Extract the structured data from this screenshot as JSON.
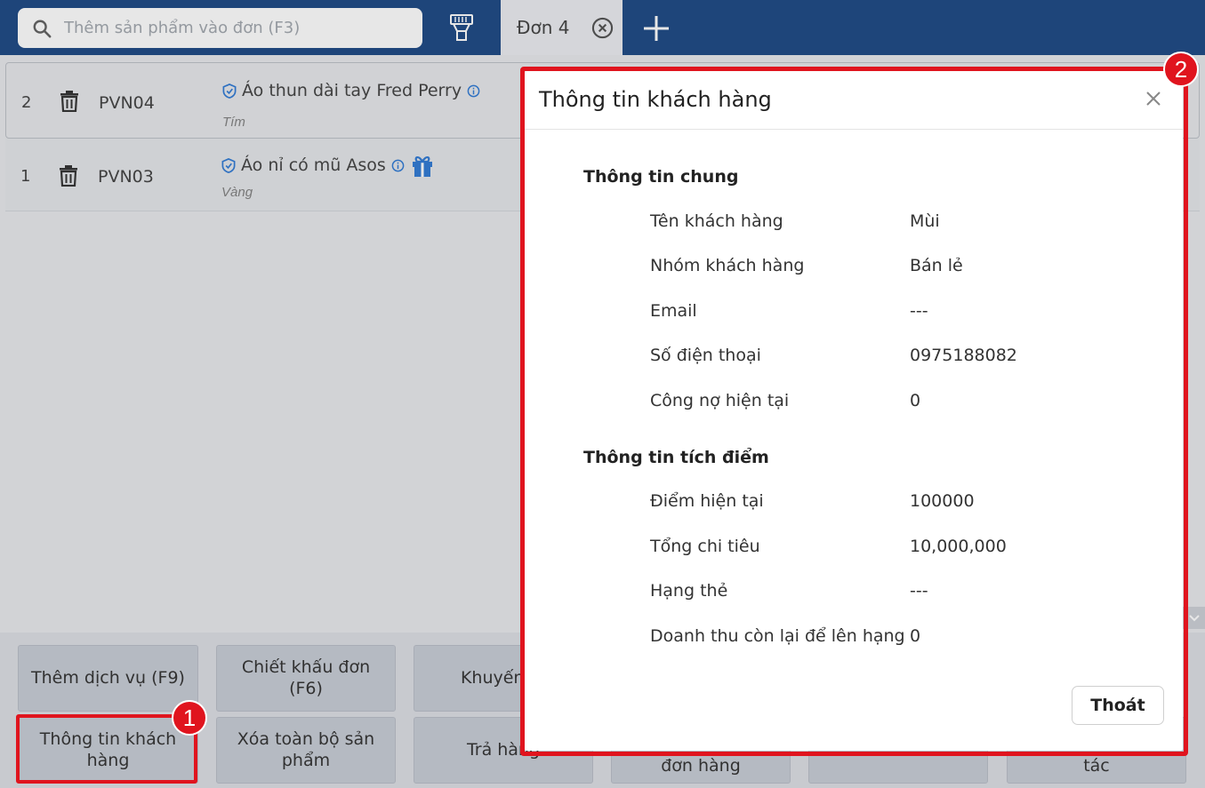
{
  "search": {
    "placeholder": "Thêm sản phẩm vào đơn (F3)"
  },
  "tabs": [
    {
      "label": "Đơn 4"
    }
  ],
  "order_items": [
    {
      "index": "2",
      "sku": "PVN04",
      "name": "Áo thun dài tay Fred Perry",
      "variant": "Tím",
      "has_gift": false
    },
    {
      "index": "1",
      "sku": "PVN03",
      "name": "Áo nỉ có mũ Asos",
      "variant": "Vàng",
      "has_gift": true
    }
  ],
  "action_buttons": {
    "add_service": "Thêm dịch vụ (F9)",
    "order_discount": "Chiết khấu đơn (F6)",
    "promotion": "Khuyến m",
    "customer_info": "Thông tin khách hàng",
    "clear_all": "Xóa toàn bộ sản phẩm",
    "return": "Trả hàng",
    "order": "đơn hàng",
    "more": "tác"
  },
  "modal": {
    "title": "Thông tin khách hàng",
    "general": {
      "title": "Thông tin chung",
      "fields": [
        {
          "label": "Tên khách hàng",
          "value": "Mùi"
        },
        {
          "label": "Nhóm khách hàng",
          "value": "Bán lẻ"
        },
        {
          "label": "Email",
          "value": "---"
        },
        {
          "label": "Số điện thoại",
          "value": "0975188082"
        },
        {
          "label": "Công nợ hiện tại",
          "value": "0"
        }
      ]
    },
    "loyalty": {
      "title": "Thông tin tích điểm",
      "fields": [
        {
          "label": "Điểm hiện tại",
          "value": "100000"
        },
        {
          "label": "Tổng chi tiêu",
          "value": "10,000,000"
        },
        {
          "label": "Hạng thẻ",
          "value": "---"
        },
        {
          "label": "Doanh thu còn lại để lên hạng",
          "value": "0"
        }
      ]
    },
    "exit_label": "Thoát"
  },
  "callouts": {
    "first": "1",
    "second": "2"
  },
  "colors": {
    "header": "#0a3a7a",
    "accent": "#1f6fd1",
    "callout": "#e0141e"
  }
}
